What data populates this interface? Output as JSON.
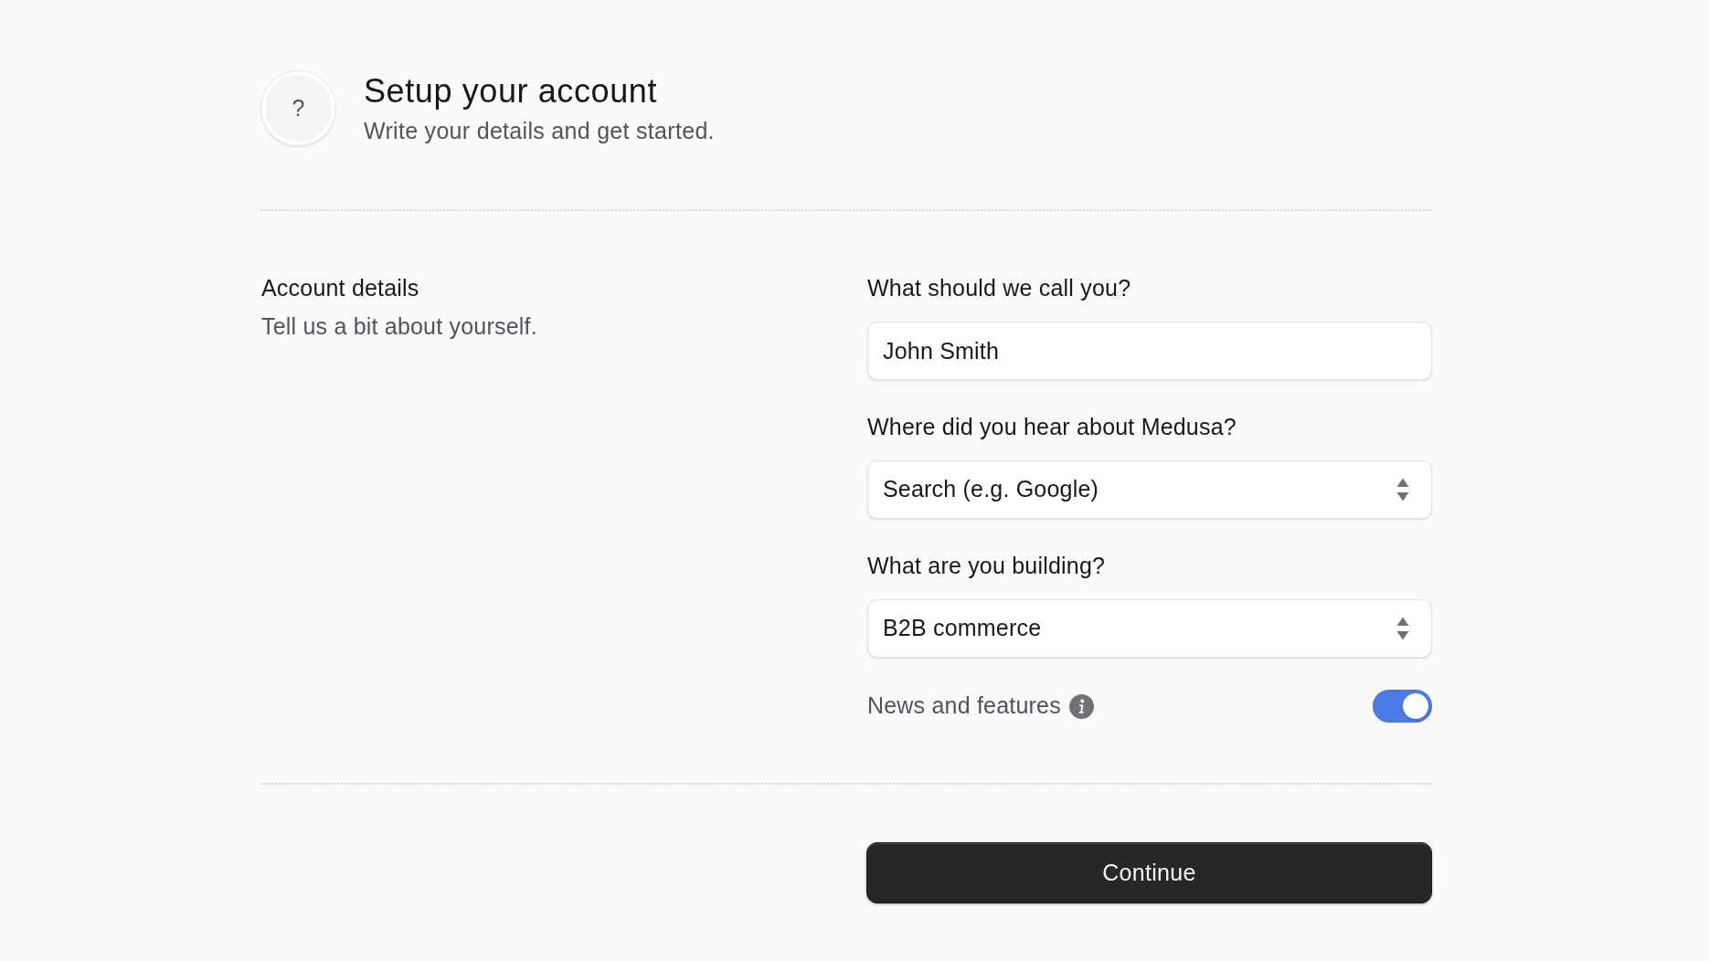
{
  "header": {
    "avatar": "?",
    "title": "Setup your account",
    "subtitle": "Write your details and get started."
  },
  "section": {
    "title": "Account details",
    "description": "Tell us a bit about yourself."
  },
  "fields": [
    {
      "kind": "text",
      "label": "What should we call you?",
      "value": "John Smith"
    },
    {
      "kind": "select",
      "label": "Where did you hear about Medusa?",
      "value": "Search (e.g. Google)"
    },
    {
      "kind": "select",
      "label": "What are you building?",
      "value": "B2B commerce"
    }
  ],
  "toggle": {
    "label": "News and features",
    "on": true
  },
  "button": {
    "label": "Continue"
  }
}
